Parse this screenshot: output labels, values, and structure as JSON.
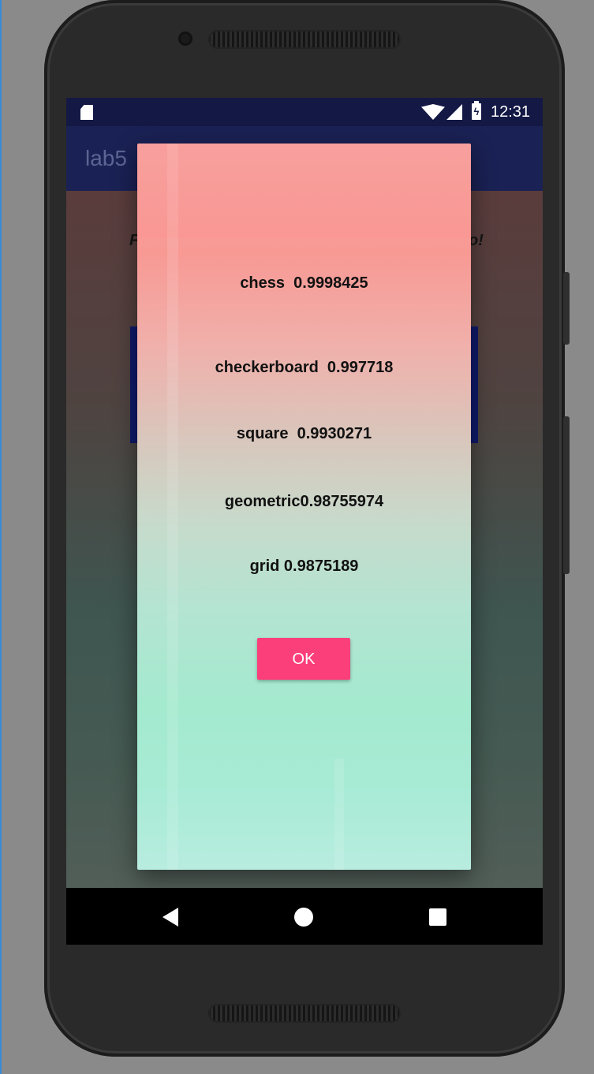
{
  "status_bar": {
    "time": "12:31",
    "icons": [
      "sd-card-icon",
      "wifi-icon",
      "signal-icon",
      "battery-charging-icon"
    ]
  },
  "app_bar": {
    "title": "lab5"
  },
  "background": {
    "text_left": "F",
    "text_right": "o!"
  },
  "dialog": {
    "results": [
      {
        "text": "chess  0.9998425"
      },
      {
        "text": "checkerboard  0.997718"
      },
      {
        "text": "square  0.9930271"
      },
      {
        "text": "geometric0.98755974"
      },
      {
        "text": "grid 0.9875189"
      }
    ],
    "ok_label": "OK"
  },
  "nav_bar": {
    "icons": [
      "back-icon",
      "home-icon",
      "recents-icon"
    ]
  },
  "colors": {
    "status_bar": "#131844",
    "app_bar": "#1a2154",
    "ok_button": "#fa3f7b",
    "dialog_top": "#f89994",
    "dialog_bottom": "#a3eacf"
  }
}
